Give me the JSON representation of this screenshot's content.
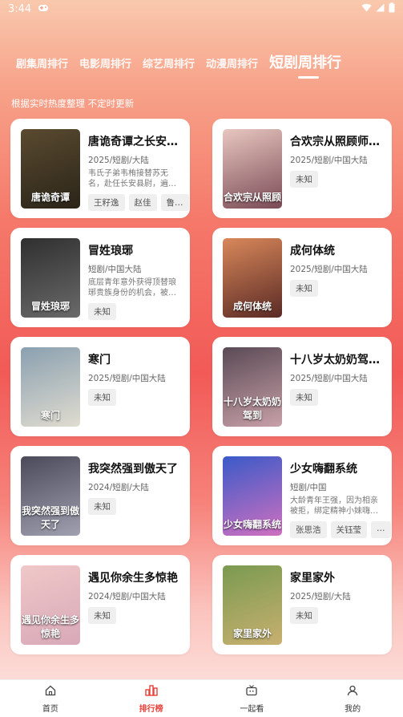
{
  "status": {
    "time": "3:44"
  },
  "tabs": [
    "剧集周排行",
    "电影周排行",
    "综艺周排行",
    "动漫周排行",
    "短剧周排行"
  ],
  "subtitle": "根据实时热度整理 不定时更新",
  "cards": [
    {
      "title": "唐诡奇谭之长安…",
      "meta": "2025/短剧/大陆",
      "desc": "韦氏子弟韦栯接替苏无名，赴任长安县尉，遍…",
      "chips": [
        "王籽逸",
        "赵佳",
        "鲁…"
      ],
      "poster_text": "唐诡奇谭",
      "colors": [
        "#5a4a30",
        "#2a2418"
      ]
    },
    {
      "title": "合欢宗从照顾师…",
      "meta": "2025/短剧/中国大陆",
      "desc": "",
      "chips": [
        "未知"
      ],
      "poster_text": "合欢宗从照顾",
      "colors": [
        "#e8c7c0",
        "#7a4a55"
      ]
    },
    {
      "title": "冒姓琅琊",
      "meta": "短剧/中国大陆",
      "desc": "底层青年意外获得顶替琅琊贵族身份的机会，被…",
      "chips": [
        "未知"
      ],
      "poster_text": "冒姓琅琊",
      "colors": [
        "#2f2f2f",
        "#6a6a6a"
      ]
    },
    {
      "title": "成何体统",
      "meta": "2025/短剧/中国大陆",
      "desc": "",
      "chips": [
        "未知"
      ],
      "poster_text": "成何体统",
      "colors": [
        "#d9885a",
        "#5a2a25"
      ]
    },
    {
      "title": "寒门",
      "meta": "2025/短剧/中国大陆",
      "desc": "",
      "chips": [
        "未知"
      ],
      "poster_text": "寒门",
      "colors": [
        "#8aa0b0",
        "#e0dcd0"
      ]
    },
    {
      "title": "十八岁太奶奶驾…",
      "meta": "2025/短剧/中国大陆",
      "desc": "",
      "chips": [
        "未知"
      ],
      "poster_text": "十八岁太奶奶驾到",
      "colors": [
        "#5a4a55",
        "#c8a0a8"
      ]
    },
    {
      "title": "我突然强到傲天了",
      "meta": "2024/短剧/大陆",
      "desc": "",
      "chips": [
        "未知"
      ],
      "poster_text": "我突然强到傲天了",
      "colors": [
        "#4a4a5a",
        "#a0a0b0"
      ]
    },
    {
      "title": "少女嗨翻系统",
      "meta": "短剧/中国",
      "desc": "大龄青年王强，因为相亲被拒，绑定精神小妹嗨…",
      "chips": [
        "张思浩",
        "关钰莹",
        "…"
      ],
      "poster_text": "少女嗨翻系统",
      "colors": [
        "#3a5ac8",
        "#d070c0"
      ]
    },
    {
      "title": "遇见你余生多惊艳",
      "meta": "2024/短剧/中国大陆",
      "desc": "",
      "chips": [
        "未知"
      ],
      "poster_text": "遇见你余生多惊艳",
      "colors": [
        "#f0c8c8",
        "#d8a8b8"
      ]
    },
    {
      "title": "家里家外",
      "meta": "2025/短剧/大陆",
      "desc": "",
      "chips": [
        "未知"
      ],
      "poster_text": "家里家外",
      "colors": [
        "#7a9a50",
        "#c8b070"
      ]
    }
  ],
  "nav": [
    {
      "label": "首页",
      "icon": "home-icon"
    },
    {
      "label": "排行榜",
      "icon": "chart-icon"
    },
    {
      "label": "一起看",
      "icon": "tv-icon"
    },
    {
      "label": "我的",
      "icon": "user-icon"
    }
  ],
  "accent": "#e8413a"
}
